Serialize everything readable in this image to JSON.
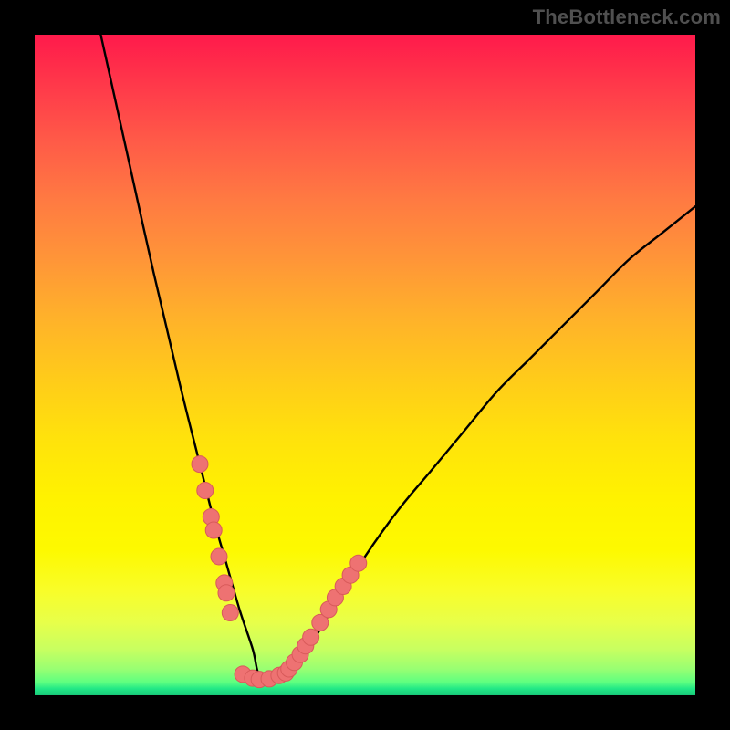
{
  "attribution": "TheBottleneck.com",
  "chart_data": {
    "type": "line",
    "title": "",
    "xlabel": "",
    "ylabel": "",
    "xlim": [
      0,
      100
    ],
    "ylim": [
      0,
      100
    ],
    "grid": false,
    "description": "Bottleneck-style V-curve over a vertical red→yellow→green gradient. Minimum near x≈34, y≈0. Left arm rises to 100 at x≈10; right arm rises toward ~75 at x=100. Salmon marker segments overlaid along the curve near the trough.",
    "series": [
      {
        "name": "bottleneck-curve",
        "x": [
          10,
          14,
          18,
          22,
          25,
          27,
          29,
          31,
          33,
          34,
          36,
          38,
          40,
          42,
          45,
          50,
          55,
          60,
          65,
          70,
          75,
          80,
          85,
          90,
          95,
          100
        ],
        "y": [
          100,
          82,
          64,
          47,
          35,
          27,
          20,
          13,
          7,
          3,
          2,
          3,
          5,
          8,
          13,
          21,
          28,
          34,
          40,
          46,
          51,
          56,
          61,
          66,
          70,
          74
        ]
      }
    ],
    "markers": [
      {
        "name": "left-arm-markers",
        "x": [
          25.0,
          25.8,
          26.7,
          27.1,
          27.9,
          28.7,
          29.0,
          29.6
        ],
        "y": [
          35.0,
          31.0,
          27.0,
          25.0,
          21.0,
          17.0,
          15.5,
          12.5
        ]
      },
      {
        "name": "trough-markers",
        "x": [
          31.5,
          33.0,
          34.0,
          35.5,
          37.0,
          38.0
        ],
        "y": [
          3.2,
          2.6,
          2.4,
          2.5,
          3.0,
          3.4
        ]
      },
      {
        "name": "right-arm-markers",
        "x": [
          38.5,
          39.3,
          40.2,
          41.0,
          41.8,
          43.2,
          44.5,
          45.5,
          46.7,
          47.8,
          49.0
        ],
        "y": [
          4.0,
          5.0,
          6.2,
          7.5,
          8.8,
          11.0,
          13.0,
          14.8,
          16.5,
          18.2,
          20.0
        ]
      }
    ],
    "colors": {
      "curve": "#000000",
      "marker_fill": "#ee7272",
      "marker_stroke": "#d85a5a"
    }
  }
}
